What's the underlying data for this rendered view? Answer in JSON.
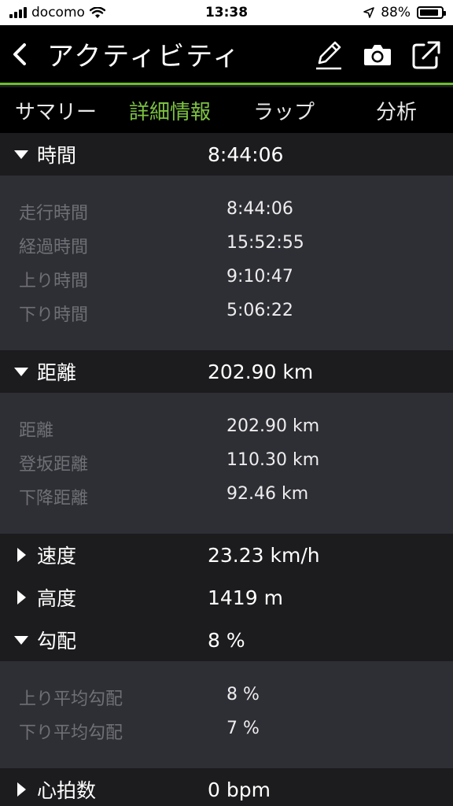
{
  "status_bar": {
    "carrier": "docomo",
    "time": "13:38",
    "battery_percent": "88%",
    "battery_level": 0.88
  },
  "nav": {
    "back_icon": "chevron-left-icon",
    "title": "アクティビティ",
    "actions": [
      "edit-icon",
      "camera-icon",
      "share-icon"
    ]
  },
  "tabs": [
    {
      "label": "サマリー",
      "active": false
    },
    {
      "label": "詳細情報",
      "active": true
    },
    {
      "label": "ラップ",
      "active": false
    },
    {
      "label": "分析",
      "active": false
    }
  ],
  "colors": {
    "accent": "#7dc242",
    "nav_bg": "#000000",
    "section_bg": "#1c1c1e",
    "detail_bg": "#2e2e35"
  },
  "sections": {
    "time": {
      "label": "時間",
      "value": "8:44:06",
      "expanded": true,
      "rows": [
        {
          "label": "走行時間",
          "value": "8:44:06"
        },
        {
          "label": "経過時間",
          "value": "15:52:55"
        },
        {
          "label": "上り時間",
          "value": "9:10:47"
        },
        {
          "label": "下り時間",
          "value": "5:06:22"
        }
      ]
    },
    "distance": {
      "label": "距離",
      "value": "202.90 km",
      "expanded": true,
      "rows": [
        {
          "label": "距離",
          "value": "202.90 km"
        },
        {
          "label": "登坂距離",
          "value": "110.30 km"
        },
        {
          "label": "下降距離",
          "value": "92.46 km"
        }
      ]
    },
    "speed": {
      "label": "速度",
      "value": "23.23 km/h",
      "expanded": false
    },
    "altitude": {
      "label": "高度",
      "value": "1419 m",
      "expanded": false
    },
    "gradient": {
      "label": "勾配",
      "value": "8 %",
      "expanded": true,
      "rows": [
        {
          "label": "上り平均勾配",
          "value": "8 %"
        },
        {
          "label": "下り平均勾配",
          "value": "7 %"
        }
      ]
    },
    "heart_rate": {
      "label": "心拍数",
      "value": "0 bpm",
      "expanded": false
    }
  }
}
